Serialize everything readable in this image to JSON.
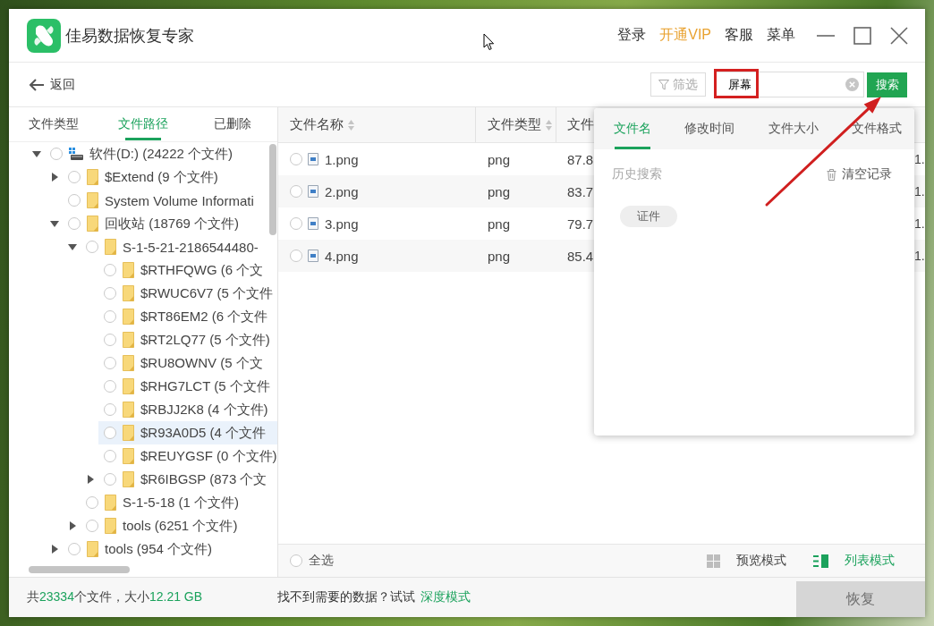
{
  "window": {
    "title": "佳易数据恢复专家",
    "menu": [
      {
        "label": "登录",
        "kind": "plain"
      },
      {
        "label": "开通VIP",
        "kind": "vip"
      },
      {
        "label": "客服",
        "kind": "plain"
      },
      {
        "label": "菜单",
        "kind": "plain"
      }
    ]
  },
  "toolbar": {
    "back": "返回",
    "filter": "筛选",
    "search": {
      "value": "屏幕",
      "highlighted": true,
      "button": "搜索"
    }
  },
  "sidebar": {
    "tabs": [
      {
        "label": "文件类型",
        "selected": false
      },
      {
        "label": "文件路径",
        "selected": true
      },
      {
        "label": "已删除",
        "selected": false
      }
    ],
    "tree": [
      {
        "label": "软件(D:) (24222 个文件)",
        "kind": "drive",
        "expanded": true,
        "checked": false,
        "selected": false,
        "children": [
          {
            "label": "$Extend (9 个文件)",
            "kind": "folder",
            "expanded": false,
            "checked": false,
            "selected": false
          },
          {
            "label": "System Volume Informati",
            "kind": "folder",
            "checked": false,
            "selected": false
          },
          {
            "label": "回收站 (18769 个文件)",
            "kind": "folder",
            "expanded": true,
            "checked": false,
            "selected": false,
            "children": [
              {
                "label": "S-1-5-21-2186544480-",
                "kind": "folder",
                "expanded": true,
                "checked": false,
                "selected": false,
                "children": [
                  {
                    "label": "$RTHFQWG (6 个文",
                    "kind": "folder",
                    "checked": false,
                    "selected": false
                  },
                  {
                    "label": "$RWUC6V7 (5 个文件",
                    "kind": "folder",
                    "checked": false,
                    "selected": false
                  },
                  {
                    "label": "$RT86EM2 (6 个文件",
                    "kind": "folder",
                    "checked": false,
                    "selected": false
                  },
                  {
                    "label": "$RT2LQ77 (5 个文件)",
                    "kind": "folder",
                    "checked": false,
                    "selected": false
                  },
                  {
                    "label": "$RU8OWNV (5 个文",
                    "kind": "folder",
                    "checked": false,
                    "selected": false
                  },
                  {
                    "label": "$RHG7LCT (5 个文件",
                    "kind": "folder",
                    "checked": false,
                    "selected": false
                  },
                  {
                    "label": "$RBJJ2K8 (4 个文件)",
                    "kind": "folder",
                    "checked": false,
                    "selected": false
                  },
                  {
                    "label": "$R93A0D5 (4 个文件",
                    "kind": "folder",
                    "checked": false,
                    "selected": true
                  },
                  {
                    "label": "$REUYGSF (0 个文件)",
                    "kind": "folder",
                    "checked": false,
                    "selected": false
                  },
                  {
                    "label": "$R6IBGSP (873 个文",
                    "kind": "folder",
                    "expanded": false,
                    "checked": false,
                    "selected": false
                  }
                ]
              },
              {
                "label": "S-1-5-18 (1 个文件)",
                "kind": "folder",
                "checked": false,
                "selected": false
              },
              {
                "label": "tools (6251 个文件)",
                "kind": "folder",
                "expanded": false,
                "checked": false,
                "selected": false
              }
            ]
          },
          {
            "label": "tools (954 个文件)",
            "kind": "folder",
            "expanded": false,
            "checked": false,
            "selected": false
          }
        ]
      }
    ]
  },
  "table": {
    "columns": [
      {
        "label": "文件名称",
        "sort": true
      },
      {
        "label": "文件类型",
        "sort": true
      },
      {
        "label": "文件",
        "sort": false
      }
    ],
    "rows": [
      {
        "checked": false,
        "name": "1.png",
        "type": "png",
        "size": "87.8",
        "column_5": "1."
      },
      {
        "checked": false,
        "name": "2.png",
        "type": "png",
        "size": "83.7",
        "column_5": "1."
      },
      {
        "checked": false,
        "name": "3.png",
        "type": "png",
        "size": "79.7",
        "column_5": "1."
      },
      {
        "checked": false,
        "name": "4.png",
        "type": "png",
        "size": "85.4",
        "column_5": "1."
      }
    ],
    "select_all": {
      "label": "全选",
      "checked": false
    },
    "view_modes": [
      {
        "label": "预览模式",
        "kind": "grid",
        "selected": false
      },
      {
        "label": "列表模式",
        "kind": "list",
        "selected": true
      }
    ]
  },
  "search_popup": {
    "tabs": [
      {
        "label": "文件名",
        "selected": true
      },
      {
        "label": "修改时间",
        "selected": false
      },
      {
        "label": "文件大小",
        "selected": false
      },
      {
        "label": "文件格式",
        "selected": false
      }
    ],
    "history_title": "历史搜索",
    "clear": "清空记录",
    "history": [
      "证件"
    ]
  },
  "status_bar": {
    "summary": [
      {
        "text": "共",
        "accent": false
      },
      {
        "text": "23334",
        "accent": true
      },
      {
        "text": "个文件，大小",
        "accent": false
      },
      {
        "text": "12.21 GB",
        "accent": true
      }
    ],
    "hint": "找不到需要的数据？试试",
    "link": "深度模式",
    "restore": {
      "label": "恢复",
      "disabled": true
    }
  },
  "annotations": [
    {
      "kind": "arrow"
    }
  ]
}
